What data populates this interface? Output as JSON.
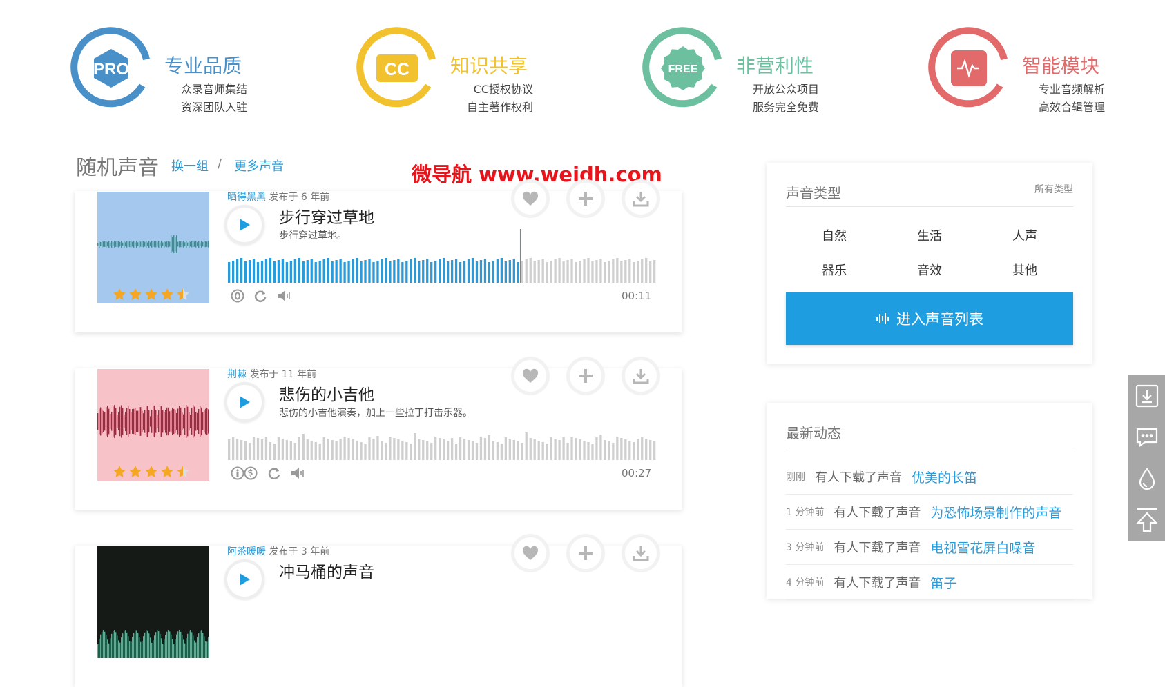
{
  "features": [
    {
      "badge": "PRO",
      "title": "专业品质",
      "line1": "众录音师集结",
      "line2": "资深团队入驻",
      "color": "#4a90c8",
      "badge_icon": "pro-hexagon-icon"
    },
    {
      "badge": "CC",
      "title": "知识共享",
      "line1": "CC授权协议",
      "line2": "自主著作权利",
      "color": "#f2c12e",
      "badge_icon": "cc-icon"
    },
    {
      "badge": "FREE",
      "title": "非营利性",
      "line1": "开放公众项目",
      "line2": "服务完全免费",
      "color": "#6cc0a0",
      "badge_icon": "free-badge-icon"
    },
    {
      "badge": "",
      "title": "智能模块",
      "line1": "专业音频解析",
      "line2": "高效合辑管理",
      "color": "#e26a6a",
      "badge_icon": "waveform-icon"
    }
  ],
  "section": {
    "title": "随机声音",
    "refresh": "换一组",
    "separator": "/",
    "more": "更多声音"
  },
  "watermark": "微导航 www.weidh.com",
  "sounds": [
    {
      "user": "晒得黑黑",
      "posted": "发布于 6 年前",
      "title": "步行穿过草地",
      "desc": "步行穿过草地。",
      "duration": "00:11",
      "rating": 4.5,
      "progress": 0.68,
      "thumb_bg": "#a4c8ee",
      "wave_color": "#2d9b83"
    },
    {
      "user": "荆棘",
      "posted": "发布于 11 年前",
      "title": "悲伤的小吉他",
      "desc": "悲伤的小吉他演奏，加上一些拉丁打击乐器。",
      "duration": "00:27",
      "rating": 4.5,
      "progress": 0,
      "thumb_bg": "#f8c3c8",
      "wave_color": "#c01b3c"
    },
    {
      "user": "阿茶暖暖",
      "posted": "发布于 3 年前",
      "title": "冲马桶的声音",
      "desc": "",
      "duration": "",
      "rating": 0,
      "progress": 0,
      "thumb_bg": "#161a16",
      "wave_color": "#22c79a"
    }
  ],
  "types_panel": {
    "title": "声音类型",
    "all": "所有类型",
    "categories": [
      "自然",
      "生活",
      "人声",
      "器乐",
      "音效",
      "其他"
    ],
    "button": "进入声音列表"
  },
  "news_panel": {
    "title": "最新动态",
    "items": [
      {
        "time": "刚刚",
        "action": "有人下载了声音",
        "sound": "优美的长笛"
      },
      {
        "time": "1 分钟前",
        "action": "有人下载了声音",
        "sound": "为恐怖场景制作的声音"
      },
      {
        "time": "3 分钟前",
        "action": "有人下载了声音",
        "sound": "电视雪花屏白噪音"
      },
      {
        "time": "4 分钟前",
        "action": "有人下载了声音",
        "sound": "笛子"
      }
    ]
  },
  "sidebar_icons": [
    "download-icon",
    "chat-icon",
    "drop-icon",
    "back-to-top-icon"
  ]
}
